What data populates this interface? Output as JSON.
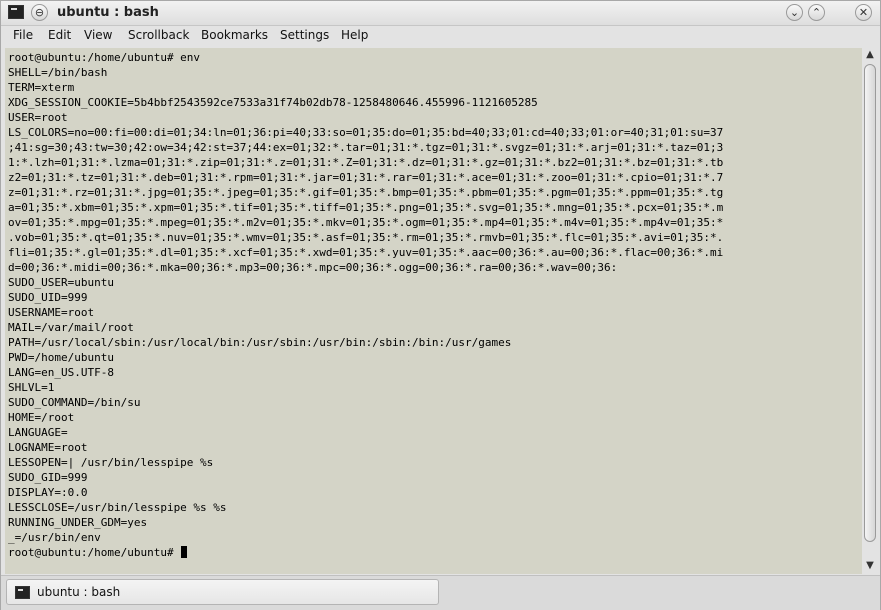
{
  "window": {
    "title": "ubuntu : bash",
    "icon": "terminal-icon",
    "controls": {
      "menu_glyph": "⊖",
      "minimize_glyph": "⌄",
      "maximize_glyph": "⌃",
      "close_glyph": "✕"
    }
  },
  "menubar": {
    "items": [
      "File",
      "Edit",
      "View",
      "Scrollback",
      "Bookmarks",
      "Settings",
      "Help"
    ]
  },
  "terminal": {
    "lines": [
      "root@ubuntu:/home/ubuntu# env",
      "SHELL=/bin/bash",
      "TERM=xterm",
      "XDG_SESSION_COOKIE=5b4bbf2543592ce7533a31f74b02db78-1258480646.455996-1121605285",
      "USER=root",
      "LS_COLORS=no=00:fi=00:di=01;34:ln=01;36:pi=40;33:so=01;35:do=01;35:bd=40;33;01:cd=40;33;01:or=40;31;01:su=37",
      ";41:sg=30;43:tw=30;42:ow=34;42:st=37;44:ex=01;32:*.tar=01;31:*.tgz=01;31:*.svgz=01;31:*.arj=01;31:*.taz=01;3",
      "1:*.lzh=01;31:*.lzma=01;31:*.zip=01;31:*.z=01;31:*.Z=01;31:*.dz=01;31:*.gz=01;31:*.bz2=01;31:*.bz=01;31:*.tb",
      "z2=01;31:*.tz=01;31:*.deb=01;31:*.rpm=01;31:*.jar=01;31:*.rar=01;31:*.ace=01;31:*.zoo=01;31:*.cpio=01;31:*.7",
      "z=01;31:*.rz=01;31:*.jpg=01;35:*.jpeg=01;35:*.gif=01;35:*.bmp=01;35:*.pbm=01;35:*.pgm=01;35:*.ppm=01;35:*.tg",
      "a=01;35:*.xbm=01;35:*.xpm=01;35:*.tif=01;35:*.tiff=01;35:*.png=01;35:*.svg=01;35:*.mng=01;35:*.pcx=01;35:*.m",
      "ov=01;35:*.mpg=01;35:*.mpeg=01;35:*.m2v=01;35:*.mkv=01;35:*.ogm=01;35:*.mp4=01;35:*.m4v=01;35:*.mp4v=01;35:*",
      ".vob=01;35:*.qt=01;35:*.nuv=01;35:*.wmv=01;35:*.asf=01;35:*.rm=01;35:*.rmvb=01;35:*.flc=01;35:*.avi=01;35:*.",
      "fli=01;35:*.gl=01;35:*.dl=01;35:*.xcf=01;35:*.xwd=01;35:*.yuv=01;35:*.aac=00;36:*.au=00;36:*.flac=00;36:*.mi",
      "d=00;36:*.midi=00;36:*.mka=00;36:*.mp3=00;36:*.mpc=00;36:*.ogg=00;36:*.ra=00;36:*.wav=00;36:",
      "SUDO_USER=ubuntu",
      "SUDO_UID=999",
      "USERNAME=root",
      "MAIL=/var/mail/root",
      "PATH=/usr/local/sbin:/usr/local/bin:/usr/sbin:/usr/bin:/sbin:/bin:/usr/games",
      "PWD=/home/ubuntu",
      "LANG=en_US.UTF-8",
      "SHLVL=1",
      "SUDO_COMMAND=/bin/su",
      "HOME=/root",
      "LANGUAGE=",
      "LOGNAME=root",
      "LESSOPEN=| /usr/bin/lesspipe %s",
      "SUDO_GID=999",
      "DISPLAY=:0.0",
      "LESSCLOSE=/usr/bin/lesspipe %s %s",
      "RUNNING_UNDER_GDM=yes",
      "_=/usr/bin/env"
    ],
    "prompt": "root@ubuntu:/home/ubuntu# ",
    "background_color": "#d4d4c7",
    "text_color": "#000000"
  },
  "scrollbar": {
    "up_glyph": "▲",
    "down_glyph": "▼"
  },
  "tabs": [
    {
      "label": "ubuntu : bash",
      "icon": "terminal-icon"
    }
  ]
}
